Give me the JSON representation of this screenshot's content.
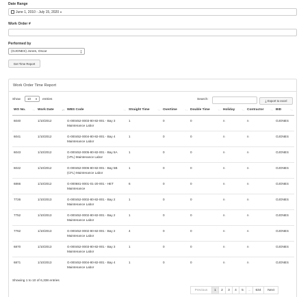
{
  "form": {
    "date_range_label": "Date Range",
    "date_range_value": "June 1, 2010 - July 15, 2020",
    "work_order_label": "Work Order #",
    "work_order_value": "",
    "performed_by_label": "Performed by",
    "performed_by_value": "(OJONES) Jones, Oscar",
    "get_report_button": "Get Time Report"
  },
  "panel": {
    "title": "Work Order Time Report",
    "show_label": "Show",
    "entries_value": "10",
    "entries_label": "entries",
    "search_label": "Search:",
    "search_value": "",
    "export_button": "Export to excel"
  },
  "table": {
    "columns": [
      "WO No.",
      "Work Date",
      "WBS Code",
      "Straight Time",
      "Overtime",
      "Double Time",
      "Holiday",
      "Contractor",
      "BID"
    ],
    "rows": [
      {
        "wo": "6040",
        "date": "1/10/2012",
        "wbs": "G-000452-0003-80-82-001 - Bay 3 Maintenance Labor",
        "st": "1",
        "ot": "0",
        "dt": "0",
        "hol": "n",
        "con": "n",
        "bid": "OJONES"
      },
      {
        "wo": "6041",
        "date": "1/10/2012",
        "wbs": "G-000452-0004-80-82-001 - Bay 4 Maintenance Labor",
        "st": "1",
        "ot": "0",
        "dt": "0",
        "hol": "n",
        "con": "n",
        "bid": "OJONES"
      },
      {
        "wo": "6043",
        "date": "1/10/2012",
        "wbs": "G-000452-0005-80-82-001 - Bay 5A (VFL) Maintenance Labor",
        "st": "1",
        "ot": "0",
        "dt": "0",
        "hol": "n",
        "con": "n",
        "bid": "OJONES"
      },
      {
        "wo": "6042",
        "date": "1/10/2012",
        "wbs": "G-000452-0006-80-82-001 - Bay 5B (CFL) Maintenance Labor",
        "st": "1",
        "ot": "0",
        "dt": "0",
        "hol": "n",
        "con": "n",
        "bid": "OJONES"
      },
      {
        "wo": "6866",
        "date": "1/10/2012",
        "wbs": "G-000681-0001-01-20-001 - HET Maintenance",
        "st": "6",
        "ot": "0",
        "dt": "0",
        "hol": "n",
        "con": "n",
        "bid": "OJONES"
      },
      {
        "wo": "7726",
        "date": "1/10/2013",
        "wbs": "G-000452-0002-80-82-001 - Bay 2 Maintenance Labor",
        "st": "1",
        "ot": "0",
        "dt": "0",
        "hol": "n",
        "con": "n",
        "bid": "OJONES"
      },
      {
        "wo": "7752",
        "date": "1/10/2013",
        "wbs": "G-000452-0002-80-82-001 - Bay 2 Maintenance Labor",
        "st": "1",
        "ot": "0",
        "dt": "0",
        "hol": "n",
        "con": "n",
        "bid": "OJONES"
      },
      {
        "wo": "7762",
        "date": "1/10/2013",
        "wbs": "G-000452-0002-80-82-001 - Bay 2 Maintenance Labor",
        "st": "4",
        "ot": "0",
        "dt": "0",
        "hol": "n",
        "con": "n",
        "bid": "OJONES"
      },
      {
        "wo": "6870",
        "date": "1/10/2013",
        "wbs": "G-000452-0003-80-82-001 - Bay 3 Maintenance Labor",
        "st": "1",
        "ot": "0",
        "dt": "0",
        "hol": "n",
        "con": "n",
        "bid": "OJONES"
      },
      {
        "wo": "6871",
        "date": "1/10/2013",
        "wbs": "G-000452-0004-80-82-001 - Bay 4 Maintenance Labor",
        "st": "1",
        "ot": "0",
        "dt": "0",
        "hol": "n",
        "con": "n",
        "bid": "OJONES"
      }
    ]
  },
  "footer": {
    "info": "Showing 1 to 10 of 6,338 entries",
    "pages": [
      "Previous",
      "1",
      "2",
      "3",
      "4",
      "5",
      "...",
      "634",
      "Next"
    ]
  }
}
